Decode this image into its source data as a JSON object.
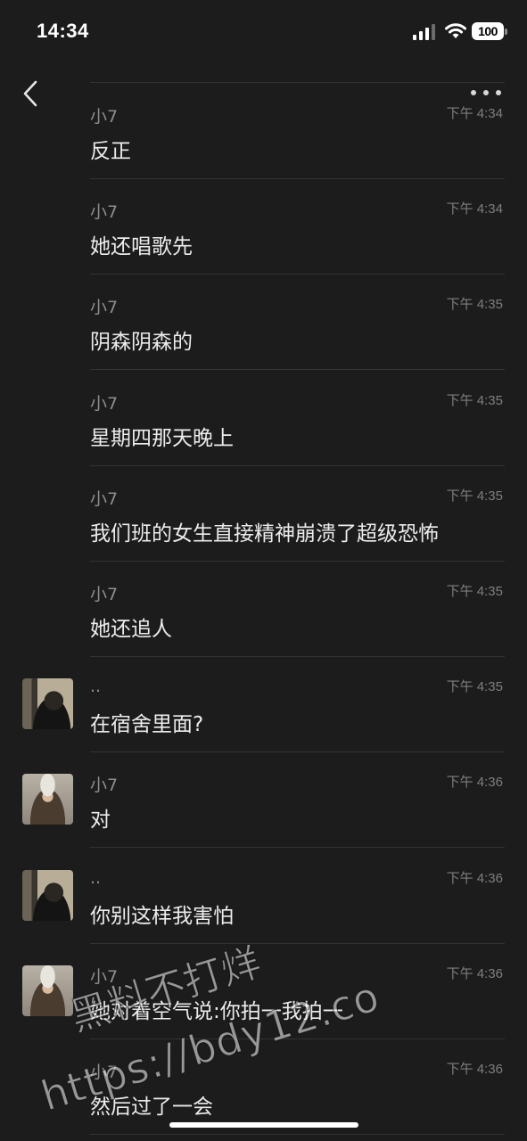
{
  "status_bar": {
    "time": "14:34",
    "battery": "100"
  },
  "messages": [
    {
      "sender": "小7",
      "time": "下午 4:34",
      "text": "反正",
      "avatar": ""
    },
    {
      "sender": "小7",
      "time": "下午 4:34",
      "text": "她还唱歌先",
      "avatar": ""
    },
    {
      "sender": "小7",
      "time": "下午 4:35",
      "text": "阴森阴森的",
      "avatar": ""
    },
    {
      "sender": "小7",
      "time": "下午 4:35",
      "text": "星期四那天晚上",
      "avatar": ""
    },
    {
      "sender": "小7",
      "time": "下午 4:35",
      "text": "我们班的女生直接精神崩溃了超级恐怖",
      "avatar": ""
    },
    {
      "sender": "小7",
      "time": "下午 4:35",
      "text": "她还追人",
      "avatar": ""
    },
    {
      "sender": "..",
      "time": "下午 4:35",
      "text": "在宿舍里面?",
      "avatar": "boy"
    },
    {
      "sender": "小7",
      "time": "下午 4:36",
      "text": "对",
      "avatar": "girl"
    },
    {
      "sender": "..",
      "time": "下午 4:36",
      "text": "你别这样我害怕",
      "avatar": "boy"
    },
    {
      "sender": "小7",
      "time": "下午 4:36",
      "text": "她对着空气说:你拍一我拍一",
      "avatar": "girl"
    },
    {
      "sender": "小7",
      "time": "下午 4:36",
      "text": "然后过了一会",
      "avatar": ""
    }
  ],
  "watermark": {
    "line1": "黑料不打烊",
    "line2": "https://bdy12.co"
  }
}
